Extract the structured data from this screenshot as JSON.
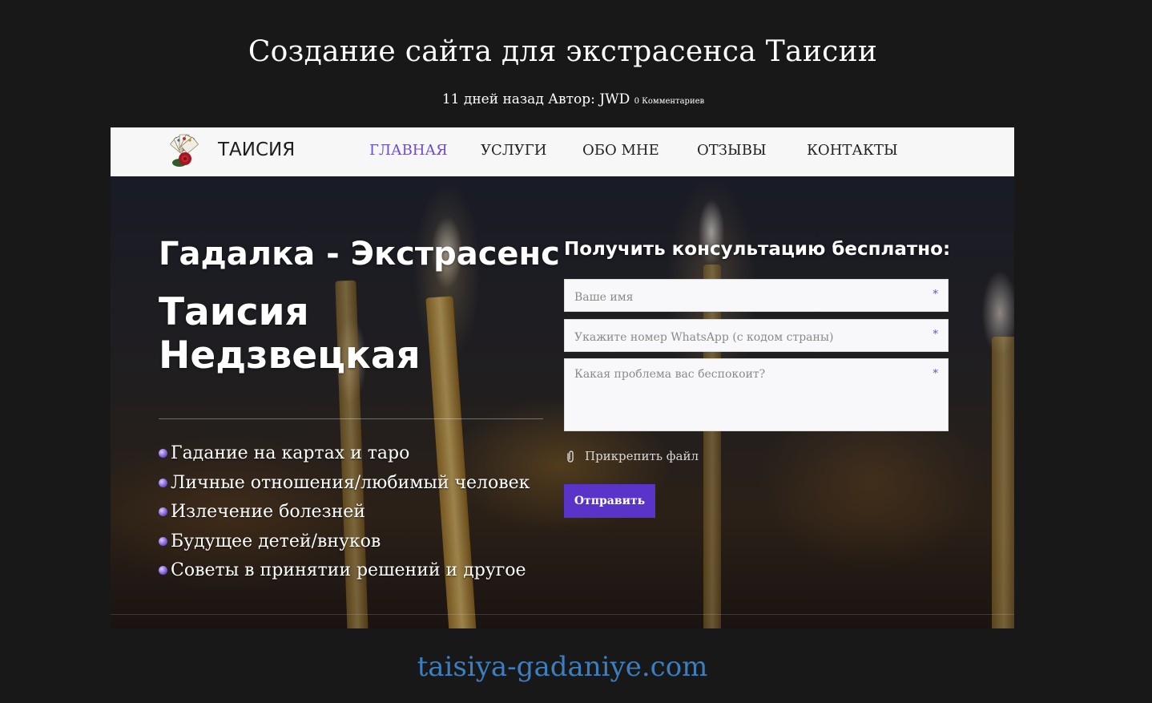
{
  "post": {
    "title": "Создание сайта для экстрасенса Таисии",
    "meta_main": "11 дней назад Автор: JWD",
    "meta_comments": "0 Комментариев"
  },
  "site": {
    "brand": "ТАИСИЯ",
    "logo_icon": "cards-rose-logo",
    "accent": "#6a4fc9",
    "button_color": "#5a34c9",
    "nav": [
      {
        "label": "ГЛАВНАЯ",
        "active": true
      },
      {
        "label": "УСЛУГИ",
        "active": false
      },
      {
        "label": "ОБО МНЕ",
        "active": false
      },
      {
        "label": "ОТЗЫВЫ",
        "active": false
      },
      {
        "label": "КОНТАКТЫ",
        "active": false
      }
    ],
    "hero": {
      "subtitle": "Гадалка - Экстрасенс",
      "name": "Таисия Недзвецкая",
      "services": [
        "Гадание на картах и таро",
        "Личные отношения/любимый человек",
        "Излечение болезней",
        "Будущее детей/внуков",
        "Советы в принятии решений и другое"
      ]
    },
    "form": {
      "title": "Получить консультацию бесплатно:",
      "name_placeholder": "Ваше имя",
      "phone_placeholder": "Укажите номер WhatsApp (с кодом страны)",
      "problem_placeholder": "Какая проблема вас беспокоит?",
      "required_mark": "*",
      "attach_label": "Прикрепить файл",
      "submit_label": "Отправить"
    }
  },
  "footer_url": "taisiya-gadaniye.com"
}
